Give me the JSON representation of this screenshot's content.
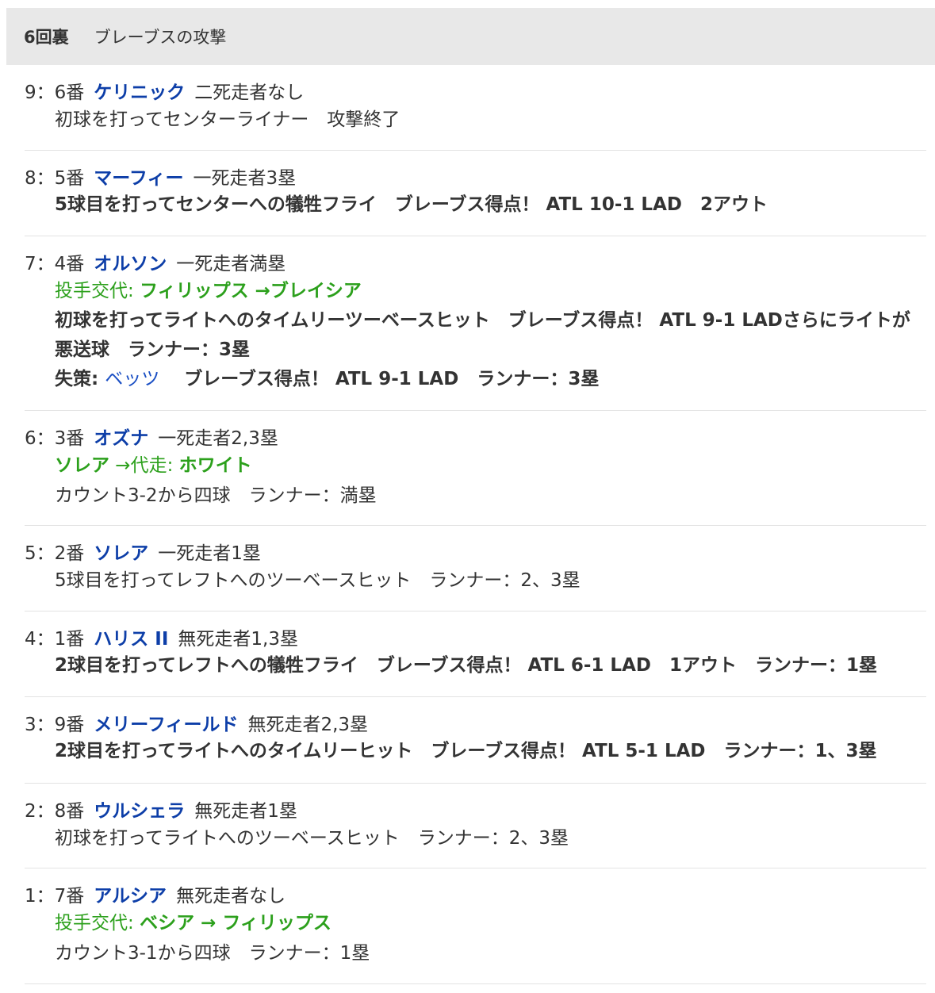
{
  "header": {
    "inning": "6回裏",
    "title": "ブレーブスの攻撃"
  },
  "plays": [
    {
      "num": "9：6番",
      "player": "ケリニック",
      "situation": "二死走者なし",
      "lines": [
        {
          "type": "normal",
          "text": "初球を打ってセンターライナー　攻撃終了"
        }
      ]
    },
    {
      "num": "8：5番",
      "player": "マーフィー",
      "situation": "一死走者3塁",
      "lines": [
        {
          "type": "bold",
          "text": "5球目を打ってセンターへの犠牲フライ　ブレーブス得点！ ATL 10-1 LAD　2アウト"
        }
      ]
    },
    {
      "num": "7：4番",
      "player": "オルソン",
      "situation": "一死走者満塁",
      "lines": [
        {
          "type": "change",
          "label": "投手交代: ",
          "from": "フィリップス",
          "arrow": " →",
          "to": "ブレイシア"
        },
        {
          "type": "bold",
          "text": "初球を打ってライトへのタイムリーツーベースヒット　ブレーブス得点！ ATL 9-1 LADさらにライトが悪送球　ランナー：3塁"
        },
        {
          "type": "error",
          "label": "失策: ",
          "fielder": "ベッツ",
          "text": "　 ブレーブス得点！ ATL 9-1 LAD　ランナー：3塁"
        }
      ]
    },
    {
      "num": "6：3番",
      "player": "オズナ",
      "situation": "一死走者2,3塁",
      "lines": [
        {
          "type": "runner",
          "from": "ソレア",
          "label": " →代走: ",
          "to": "ホワイト"
        },
        {
          "type": "normal",
          "text": "カウント3-2から四球　ランナー：満塁"
        }
      ]
    },
    {
      "num": "5：2番",
      "player": "ソレア",
      "situation": "一死走者1塁",
      "lines": [
        {
          "type": "normal",
          "text": "5球目を打ってレフトへのツーベースヒット　ランナー：2、3塁"
        }
      ]
    },
    {
      "num": "4：1番",
      "player": "ハリス II",
      "situation": "無死走者1,3塁",
      "lines": [
        {
          "type": "bold",
          "text": "2球目を打ってレフトへの犠牲フライ　ブレーブス得点！ ATL 6-1 LAD　1アウト　ランナー：1塁"
        }
      ]
    },
    {
      "num": "3：9番",
      "player": "メリーフィールド",
      "situation": "無死走者2,3塁",
      "lines": [
        {
          "type": "bold",
          "text": "2球目を打ってライトへのタイムリーヒット　ブレーブス得点！ ATL 5-1 LAD　ランナー：1、3塁"
        }
      ]
    },
    {
      "num": "2：8番",
      "player": "ウルシェラ",
      "situation": "無死走者1塁",
      "lines": [
        {
          "type": "normal",
          "text": "初球を打ってライトへのツーベースヒット　ランナー：2、3塁"
        }
      ]
    },
    {
      "num": "1：7番",
      "player": "アルシア",
      "situation": "無死走者なし",
      "lines": [
        {
          "type": "change",
          "label": "投手交代: ",
          "from": "ベシア",
          "arrow": " →",
          "to": " フィリップス"
        },
        {
          "type": "normal",
          "text": "カウント3-1から四球　ランナー：1塁"
        }
      ]
    }
  ]
}
